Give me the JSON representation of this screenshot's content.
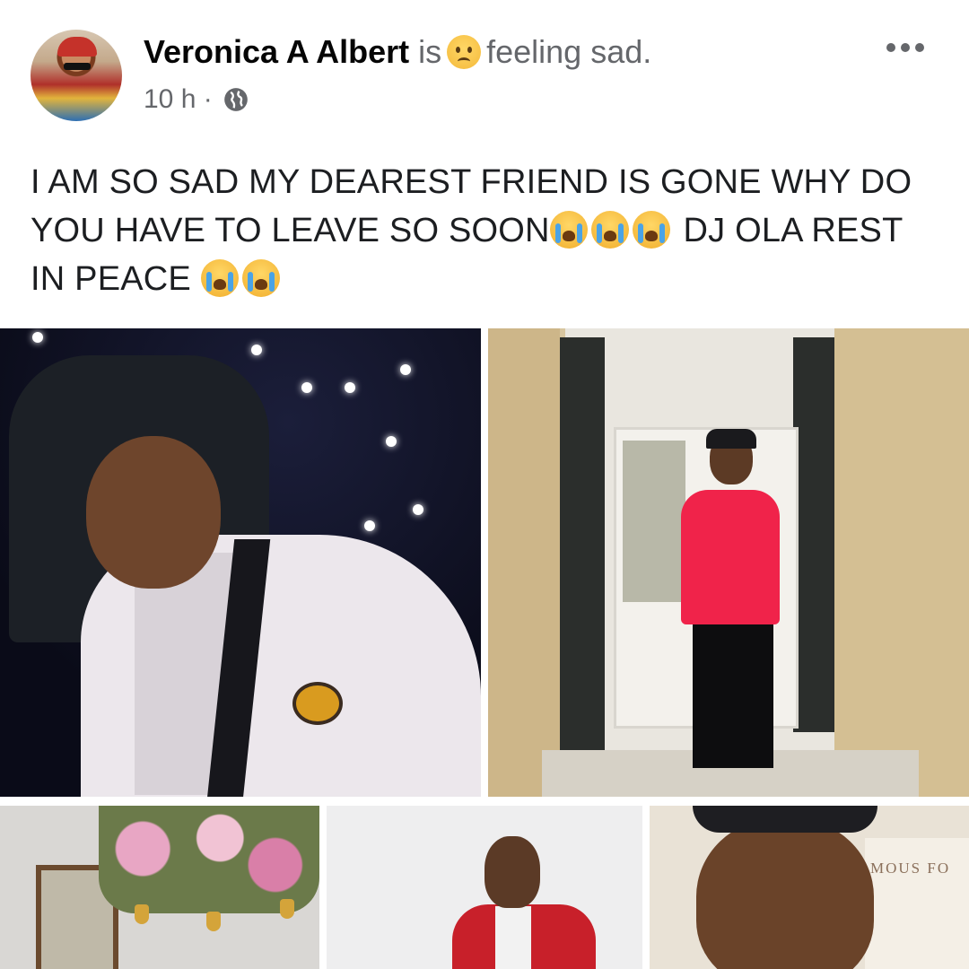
{
  "post": {
    "author": "Veronica A Albert",
    "activity_prefix": "is",
    "activity": "feeling sad.",
    "activity_icon": "sad-face-emoji",
    "time": "10 h",
    "separator": "·",
    "privacy_icon": "globe-icon",
    "text_line1": "I AM SO SAD MY DEAREST FRIEND IS GONE WHY DO",
    "text_line2_a": "YOU HAVE TO LEAVE SO SOON",
    "text_line2_b": "DJ OLA REST",
    "text_line3": "IN PEACE",
    "text_emoji": "crying-face-emoji"
  },
  "photos": {
    "count": 5,
    "sign_text": "MOUS FO"
  },
  "colors": {
    "name": "#050505",
    "secondary": "#65676b",
    "body_text": "#1c1e21"
  }
}
